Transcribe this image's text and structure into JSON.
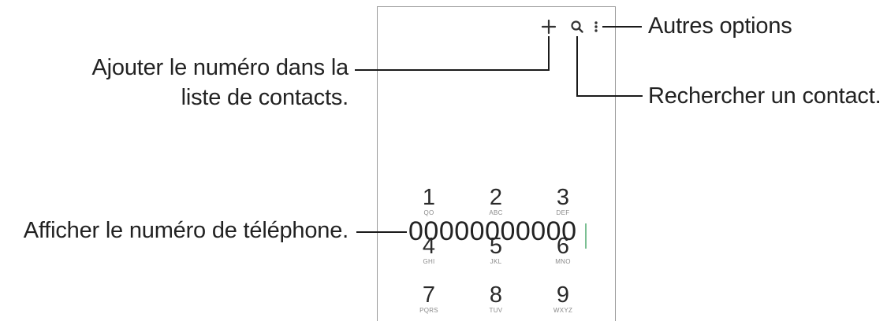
{
  "toolbar": {
    "add_icon": "plus-icon",
    "search_icon": "magnifier-icon",
    "more_icon": "vertical-ellipsis-icon"
  },
  "callouts": {
    "more_options": "Autres options",
    "add_contact_line1": "Ajouter le numéro dans la",
    "add_contact_line2": "liste de contacts.",
    "search_contact": "Rechercher un contact.",
    "show_number": "Afficher le numéro de téléphone."
  },
  "dialer": {
    "number": "00000000000"
  },
  "keypad": [
    {
      "digit": "1",
      "letters": "QO"
    },
    {
      "digit": "2",
      "letters": "ABC"
    },
    {
      "digit": "3",
      "letters": "DEF"
    },
    {
      "digit": "4",
      "letters": "GHI"
    },
    {
      "digit": "5",
      "letters": "JKL"
    },
    {
      "digit": "6",
      "letters": "MNO"
    },
    {
      "digit": "7",
      "letters": "PQRS"
    },
    {
      "digit": "8",
      "letters": "TUV"
    },
    {
      "digit": "9",
      "letters": "WXYZ"
    }
  ],
  "colors": {
    "cursor": "#7bbf93",
    "leader_line": "#1a1a1a",
    "phone_border": "#9a9a9a"
  }
}
